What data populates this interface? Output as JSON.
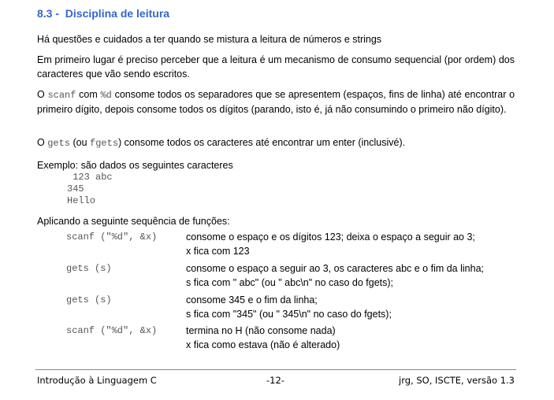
{
  "section": {
    "number": "8.3 -",
    "title": "Disciplina de leitura"
  },
  "paragraphs": {
    "intro": "Há questões e cuidados a ter quando se mistura a leitura de números e strings",
    "first": "Em primeiro lugar é preciso perceber que a leitura é um mecanismo de consumo sequencial (por ordem) dos caracteres que vão sendo escritos.",
    "scanf": {
      "lead": "O ",
      "code1": "scanf",
      "mid": " com ",
      "code2": "%d",
      "rest": " consome todos os separadores que se apresentem (espaços, fins de linha) até encontrar o primeiro dígito, depois consome todos os dígitos (parando, isto é, já não consumindo o primeiro não dígito)."
    },
    "gets": {
      "lead": "O ",
      "code1": "gets",
      "mid": " (ou ",
      "code2": "fgets",
      "rest": ") consome todos os caracteres até encontrar um enter (inclusivé)."
    },
    "example": "Exemplo: são dados os seguintes caracteres"
  },
  "example_lines": [
    " 123 abc",
    "345",
    "Hello"
  ],
  "sequence": {
    "label": "Aplicando a seguinte sequência de funções:",
    "rows": [
      {
        "code": "scanf (\"%d\", &x)",
        "desc1": "consome o espaço e os dígitos 123; deixa o espaço a seguir ao 3;",
        "desc2": "x fica com 123"
      },
      {
        "code": "gets (s)",
        "desc1": "consome o espaço a seguir ao 3, os caracteres abc e o fim da linha;",
        "desc2": "s fica com \" abc\" (ou \" abc\\n\" no caso do fgets);"
      },
      {
        "code": "gets (s)",
        "desc1": "consome 345 e o fim da linha;",
        "desc2": "s fica com \"345\" (ou \" 345\\n\" no caso do fgets);"
      },
      {
        "code": "scanf (\"%d\", &x)",
        "desc1": "termina no H (não consome nada)",
        "desc2": "x fica como estava (não é alterado)"
      }
    ]
  },
  "footer": {
    "left": "Introdução à Linguagem C",
    "center": "-12-",
    "right": "jrg, SO, ISCTE, versão 1.3"
  },
  "colors": {
    "heading": "#3366cc",
    "code": "#555555",
    "rule": "#888888"
  }
}
